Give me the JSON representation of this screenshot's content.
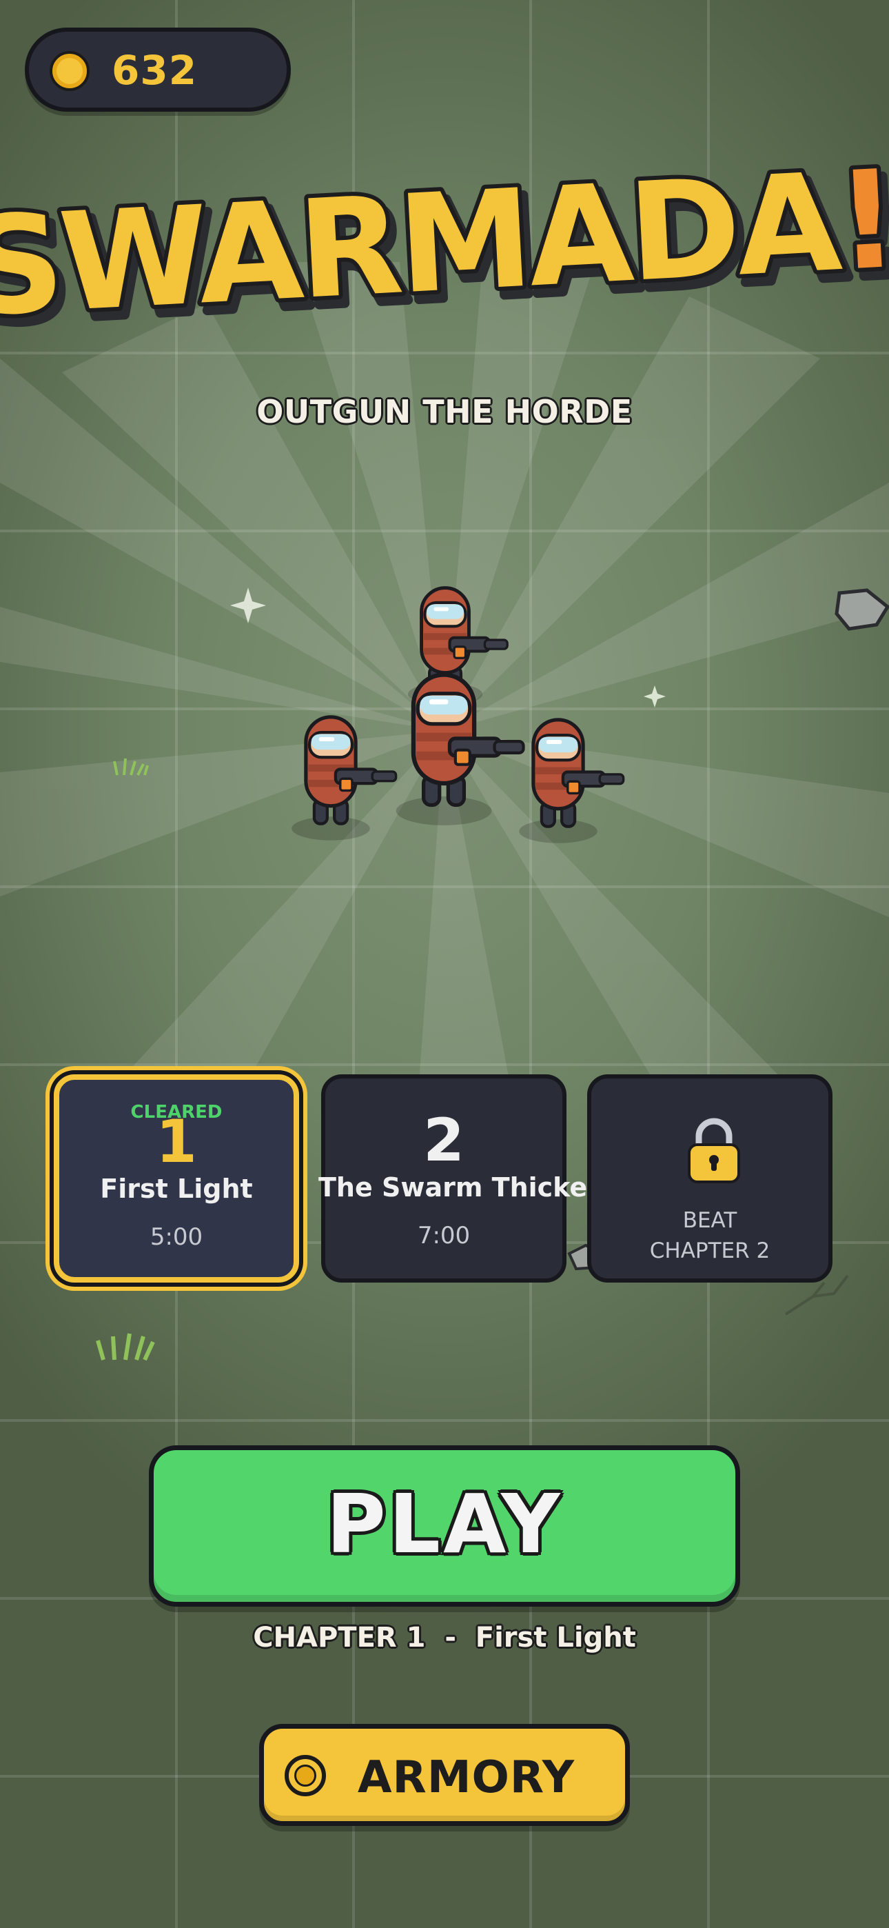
{
  "wallet": {
    "coins": "632",
    "icon": "coin-icon"
  },
  "title": {
    "main": "SWARMADA",
    "mark": "!",
    "subtitle": "OUTGUN THE HORDE"
  },
  "chapters": [
    {
      "number": "1",
      "name": "First Light",
      "time": "5:00",
      "status": "CLEARED",
      "selected": true
    },
    {
      "number": "2",
      "name": "The Swarm Thickens",
      "time": "7:00"
    },
    {
      "locked": true,
      "lock_line1": "BEAT",
      "lock_line2": "CHAPTER 2",
      "icon": "lock-icon"
    }
  ],
  "play": {
    "label": "PLAY",
    "chapter_info": "CHAPTER 1  -  First Light"
  },
  "armory": {
    "label": "ARMORY",
    "icon": "coin-icon"
  },
  "colors": {
    "accent_yellow": "#f4c43a",
    "play_green": "#52d66c",
    "cleared_green": "#4ed36b",
    "card_bg": "#2a2c37",
    "soldier_red": "#b6533a",
    "exclaim_orange": "#f08a2e"
  }
}
